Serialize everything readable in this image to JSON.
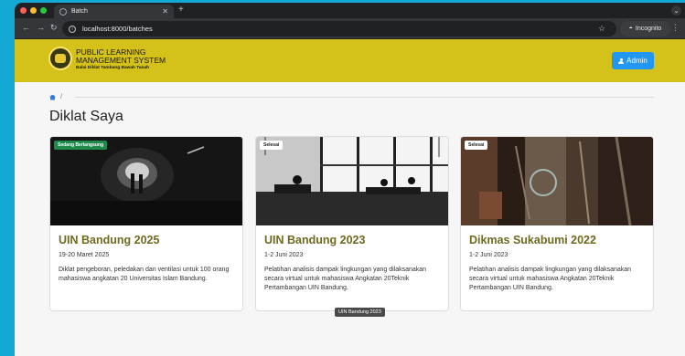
{
  "browser": {
    "tab_title": "Batch",
    "tab_close": "✕",
    "new_tab": "+",
    "url": "localhost:8000/batches",
    "incognito_label": "Incognito"
  },
  "header": {
    "brand_line1": "PUBLIC LEARNING",
    "brand_line2": "MANAGEMENT SYSTEM",
    "brand_sub": "Balai Diklat Tambang Bawah Tanah",
    "admin_button": "Admin",
    "accent_color": "#d4c11a",
    "button_color": "#2196f3"
  },
  "breadcrumb": {
    "separator": "/"
  },
  "page": {
    "title": "Diklat Saya"
  },
  "cards": [
    {
      "badge": "Sedang Berlangsung",
      "badge_color": "#1f8a4c",
      "title": "UIN Bandung 2025",
      "date": "19-20 Maret 2025",
      "description": "Diklat pengeboran, peledakan dan ventilasi untuk 100 orang mahasiswa angkatan 20 Universitas Islam Bandung."
    },
    {
      "badge": "Selesai",
      "badge_color": "#ffffff",
      "title": "UIN Bandung 2023",
      "date": "1-2 Juni 2023",
      "description": "Pelatihan analisis dampak lingkungan yang dilaksanakan secara virtual untuk mahasiswa Angkatan 20Teknik Pertambangan UIN Bandung."
    },
    {
      "badge": "Selesai",
      "badge_color": "#ffffff",
      "title": "Dikmas Sukabumi 2022",
      "date": "1-2 Juni 2023",
      "description": "Pelatihan analisis dampak lingkungan yang dilaksanakan secara virtual untuk mahasiswa Angkatan 20Teknik Pertambangan UIN Bandung."
    }
  ],
  "tooltip": "UIN Bandung 2023"
}
